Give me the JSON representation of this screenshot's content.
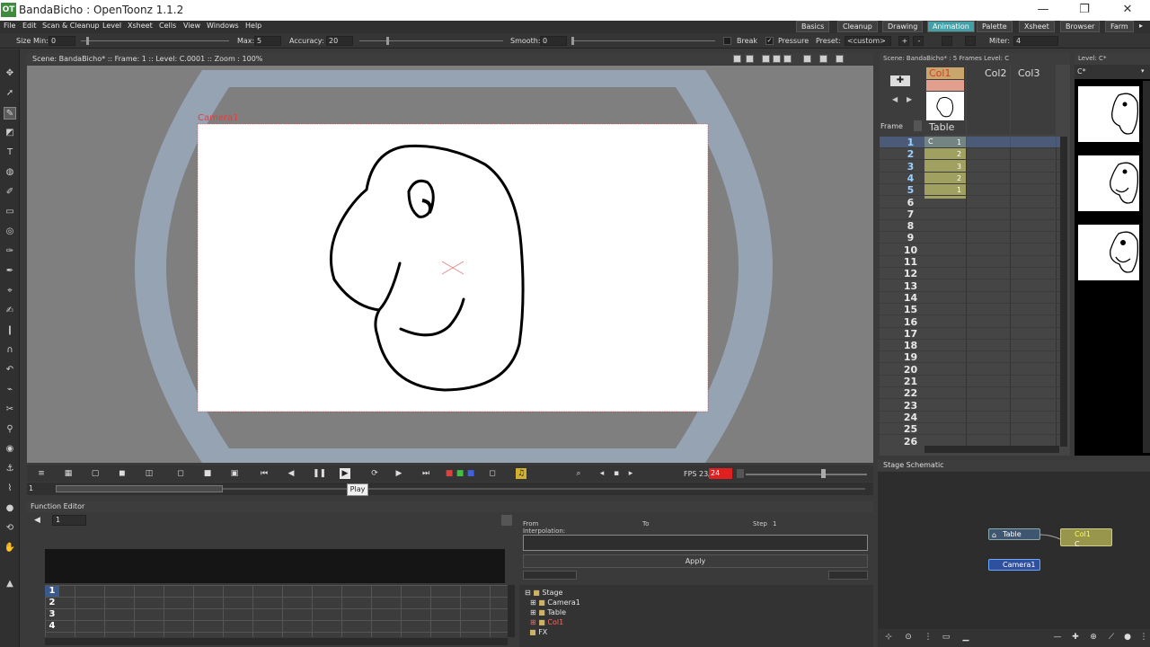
{
  "window": {
    "title": "BandaBicho : OpenToonz 1.1.2",
    "logo_text": "OT",
    "minimize_glyph": "—",
    "restore_glyph": "❐",
    "close_glyph": "✕"
  },
  "menu": [
    "File",
    "Edit",
    "Scan & Cleanup",
    "Level",
    "Xsheet",
    "Cells",
    "View",
    "Windows",
    "Help"
  ],
  "rooms": [
    {
      "label": "Basics",
      "active": false
    },
    {
      "label": "Cleanup",
      "active": false
    },
    {
      "label": "Drawing",
      "active": false
    },
    {
      "label": "Animation",
      "active": true
    },
    {
      "label": "Palette",
      "active": false
    },
    {
      "label": "Xsheet",
      "active": false
    },
    {
      "label": "Browser",
      "active": false
    },
    {
      "label": "Farm",
      "active": false
    }
  ],
  "tool_options": {
    "size_min_label": "Size Min:",
    "size_min_value": "0",
    "max_label": "Max:",
    "max_value": "5",
    "accuracy_label": "Accuracy:",
    "accuracy_value": "20",
    "smooth_label": "Smooth:",
    "smooth_value": "0",
    "break_label": "Break",
    "pressure_label": "Pressure",
    "preset_label": "Preset:",
    "preset_value": "<custom>",
    "add_label": "+",
    "remove_label": "-",
    "miter_label": "Miter:",
    "miter_value": "4"
  },
  "viewer": {
    "header": "Scene: BandaBicho*  ::  Frame: 1  ::  Level: C.0001  ::  Zoom : 100%",
    "camera_label": "Camera1",
    "fps_label": "FPS 23/",
    "fps_value": "24",
    "frame_field": "1",
    "tooltip": "Play"
  },
  "function_editor": {
    "title": "Function Editor",
    "frame_field": "1",
    "from_label": "From",
    "to_label": "To",
    "step_label": "Step",
    "step_value": "1",
    "interpolation_label": "Interpolation:",
    "apply_label": "Apply",
    "rows": [
      "1",
      "2",
      "3",
      "4"
    ],
    "tree": [
      {
        "label": "Stage",
        "level": 0,
        "color": "#e6e6e6"
      },
      {
        "label": "Camera1",
        "level": 1,
        "color": "#e6e6e6"
      },
      {
        "label": "Table",
        "level": 1,
        "color": "#e6e6e6"
      },
      {
        "label": "Col1",
        "level": 1,
        "color": "#ff6a5c"
      },
      {
        "label": "FX",
        "level": 0,
        "color": "#e6e6e6"
      }
    ]
  },
  "xsheet": {
    "header": "Scene: BandaBicho*  :  5 Frames Level: C",
    "frame_label": "Frame",
    "columns": [
      "Col1",
      "Col2",
      "Col3"
    ],
    "table_label": "Table",
    "rows": [
      "1",
      "2",
      "3",
      "4",
      "5",
      "6",
      "7",
      "8",
      "9",
      "10",
      "11",
      "12",
      "13",
      "14",
      "15",
      "16",
      "17",
      "18",
      "19",
      "20",
      "21",
      "22",
      "23",
      "24",
      "25",
      "26"
    ],
    "cells": [
      {
        "level": "C",
        "frame": "1"
      },
      {
        "level": "",
        "frame": "2"
      },
      {
        "level": "",
        "frame": "3"
      },
      {
        "level": "",
        "frame": "2"
      },
      {
        "level": "",
        "frame": "1"
      }
    ]
  },
  "level_strip": {
    "header": "Level: C*",
    "level_name": "C*"
  },
  "schematic": {
    "title": "Stage Schematic",
    "nodes": {
      "table": "Table",
      "col1": "Col1",
      "col1_sub": "C",
      "camera": "Camera1"
    }
  },
  "colors": {
    "accent": "#42a0a6",
    "xsheet_cell": "#a0a060",
    "camera_red": "#e04040",
    "fps_warn": "#e02020"
  }
}
